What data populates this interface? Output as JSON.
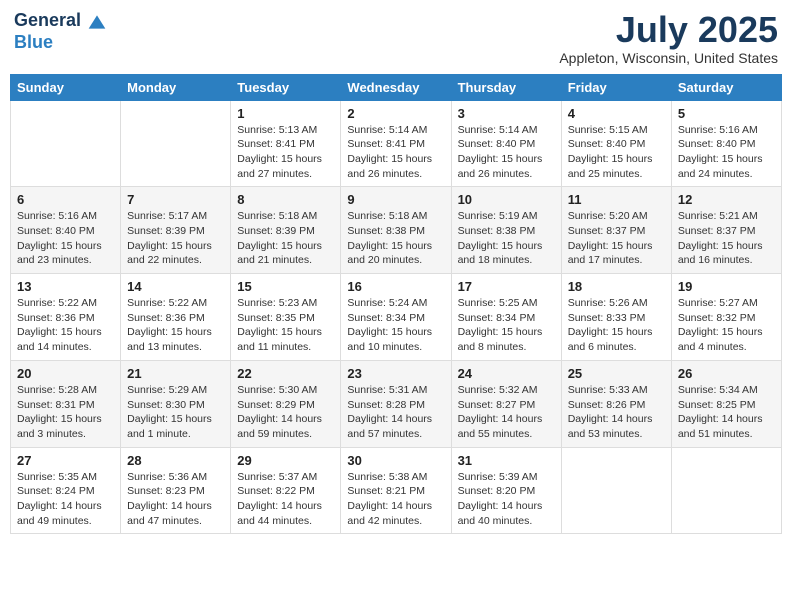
{
  "logo": {
    "general": "General",
    "blue": "Blue"
  },
  "header": {
    "month": "July 2025",
    "location": "Appleton, Wisconsin, United States"
  },
  "days_of_week": [
    "Sunday",
    "Monday",
    "Tuesday",
    "Wednesday",
    "Thursday",
    "Friday",
    "Saturday"
  ],
  "weeks": [
    [
      {
        "day": "",
        "info": ""
      },
      {
        "day": "",
        "info": ""
      },
      {
        "day": "1",
        "info": "Sunrise: 5:13 AM\nSunset: 8:41 PM\nDaylight: 15 hours and 27 minutes."
      },
      {
        "day": "2",
        "info": "Sunrise: 5:14 AM\nSunset: 8:41 PM\nDaylight: 15 hours and 26 minutes."
      },
      {
        "day": "3",
        "info": "Sunrise: 5:14 AM\nSunset: 8:40 PM\nDaylight: 15 hours and 26 minutes."
      },
      {
        "day": "4",
        "info": "Sunrise: 5:15 AM\nSunset: 8:40 PM\nDaylight: 15 hours and 25 minutes."
      },
      {
        "day": "5",
        "info": "Sunrise: 5:16 AM\nSunset: 8:40 PM\nDaylight: 15 hours and 24 minutes."
      }
    ],
    [
      {
        "day": "6",
        "info": "Sunrise: 5:16 AM\nSunset: 8:40 PM\nDaylight: 15 hours and 23 minutes."
      },
      {
        "day": "7",
        "info": "Sunrise: 5:17 AM\nSunset: 8:39 PM\nDaylight: 15 hours and 22 minutes."
      },
      {
        "day": "8",
        "info": "Sunrise: 5:18 AM\nSunset: 8:39 PM\nDaylight: 15 hours and 21 minutes."
      },
      {
        "day": "9",
        "info": "Sunrise: 5:18 AM\nSunset: 8:38 PM\nDaylight: 15 hours and 20 minutes."
      },
      {
        "day": "10",
        "info": "Sunrise: 5:19 AM\nSunset: 8:38 PM\nDaylight: 15 hours and 18 minutes."
      },
      {
        "day": "11",
        "info": "Sunrise: 5:20 AM\nSunset: 8:37 PM\nDaylight: 15 hours and 17 minutes."
      },
      {
        "day": "12",
        "info": "Sunrise: 5:21 AM\nSunset: 8:37 PM\nDaylight: 15 hours and 16 minutes."
      }
    ],
    [
      {
        "day": "13",
        "info": "Sunrise: 5:22 AM\nSunset: 8:36 PM\nDaylight: 15 hours and 14 minutes."
      },
      {
        "day": "14",
        "info": "Sunrise: 5:22 AM\nSunset: 8:36 PM\nDaylight: 15 hours and 13 minutes."
      },
      {
        "day": "15",
        "info": "Sunrise: 5:23 AM\nSunset: 8:35 PM\nDaylight: 15 hours and 11 minutes."
      },
      {
        "day": "16",
        "info": "Sunrise: 5:24 AM\nSunset: 8:34 PM\nDaylight: 15 hours and 10 minutes."
      },
      {
        "day": "17",
        "info": "Sunrise: 5:25 AM\nSunset: 8:34 PM\nDaylight: 15 hours and 8 minutes."
      },
      {
        "day": "18",
        "info": "Sunrise: 5:26 AM\nSunset: 8:33 PM\nDaylight: 15 hours and 6 minutes."
      },
      {
        "day": "19",
        "info": "Sunrise: 5:27 AM\nSunset: 8:32 PM\nDaylight: 15 hours and 4 minutes."
      }
    ],
    [
      {
        "day": "20",
        "info": "Sunrise: 5:28 AM\nSunset: 8:31 PM\nDaylight: 15 hours and 3 minutes."
      },
      {
        "day": "21",
        "info": "Sunrise: 5:29 AM\nSunset: 8:30 PM\nDaylight: 15 hours and 1 minute."
      },
      {
        "day": "22",
        "info": "Sunrise: 5:30 AM\nSunset: 8:29 PM\nDaylight: 14 hours and 59 minutes."
      },
      {
        "day": "23",
        "info": "Sunrise: 5:31 AM\nSunset: 8:28 PM\nDaylight: 14 hours and 57 minutes."
      },
      {
        "day": "24",
        "info": "Sunrise: 5:32 AM\nSunset: 8:27 PM\nDaylight: 14 hours and 55 minutes."
      },
      {
        "day": "25",
        "info": "Sunrise: 5:33 AM\nSunset: 8:26 PM\nDaylight: 14 hours and 53 minutes."
      },
      {
        "day": "26",
        "info": "Sunrise: 5:34 AM\nSunset: 8:25 PM\nDaylight: 14 hours and 51 minutes."
      }
    ],
    [
      {
        "day": "27",
        "info": "Sunrise: 5:35 AM\nSunset: 8:24 PM\nDaylight: 14 hours and 49 minutes."
      },
      {
        "day": "28",
        "info": "Sunrise: 5:36 AM\nSunset: 8:23 PM\nDaylight: 14 hours and 47 minutes."
      },
      {
        "day": "29",
        "info": "Sunrise: 5:37 AM\nSunset: 8:22 PM\nDaylight: 14 hours and 44 minutes."
      },
      {
        "day": "30",
        "info": "Sunrise: 5:38 AM\nSunset: 8:21 PM\nDaylight: 14 hours and 42 minutes."
      },
      {
        "day": "31",
        "info": "Sunrise: 5:39 AM\nSunset: 8:20 PM\nDaylight: 14 hours and 40 minutes."
      },
      {
        "day": "",
        "info": ""
      },
      {
        "day": "",
        "info": ""
      }
    ]
  ]
}
